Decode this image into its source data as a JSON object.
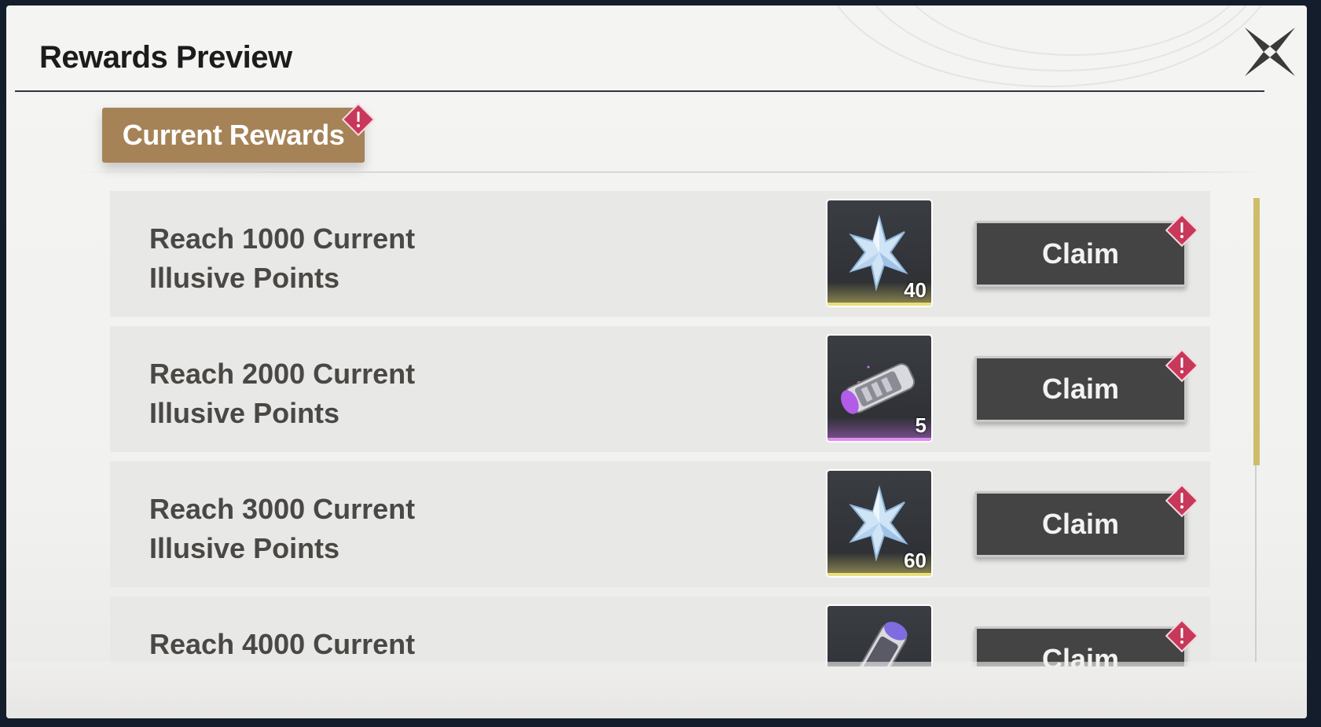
{
  "header": {
    "title": "Rewards Preview"
  },
  "close": {
    "icon": "close-x-icon"
  },
  "tab": {
    "label": "Current Rewards",
    "badge_icon": "alert-icon"
  },
  "rewards": [
    {
      "text_line1": "Reach 1000 Current",
      "text_line2": "Illusive Points",
      "item_icon": "star-crystal-icon",
      "quantity": "40",
      "rarity": "gold",
      "button": "Claim"
    },
    {
      "text_line1": "Reach 2000 Current",
      "text_line2": "Illusive Points",
      "item_icon": "purple-tube-icon",
      "quantity": "5",
      "rarity": "purple",
      "button": "Claim"
    },
    {
      "text_line1": "Reach 3000 Current",
      "text_line2": "Illusive Points",
      "item_icon": "star-crystal-icon",
      "quantity": "60",
      "rarity": "gold",
      "button": "Claim"
    },
    {
      "text_line1": "Reach 4000 Current",
      "text_line2": "",
      "item_icon": "purple-tube-icon",
      "quantity": "",
      "rarity": "purple",
      "button": "Claim"
    }
  ],
  "colors": {
    "tab": "#a58357",
    "claim_button": "#444444",
    "badge": "#c8385a",
    "scroll_thumb": "#cdbd6a"
  }
}
